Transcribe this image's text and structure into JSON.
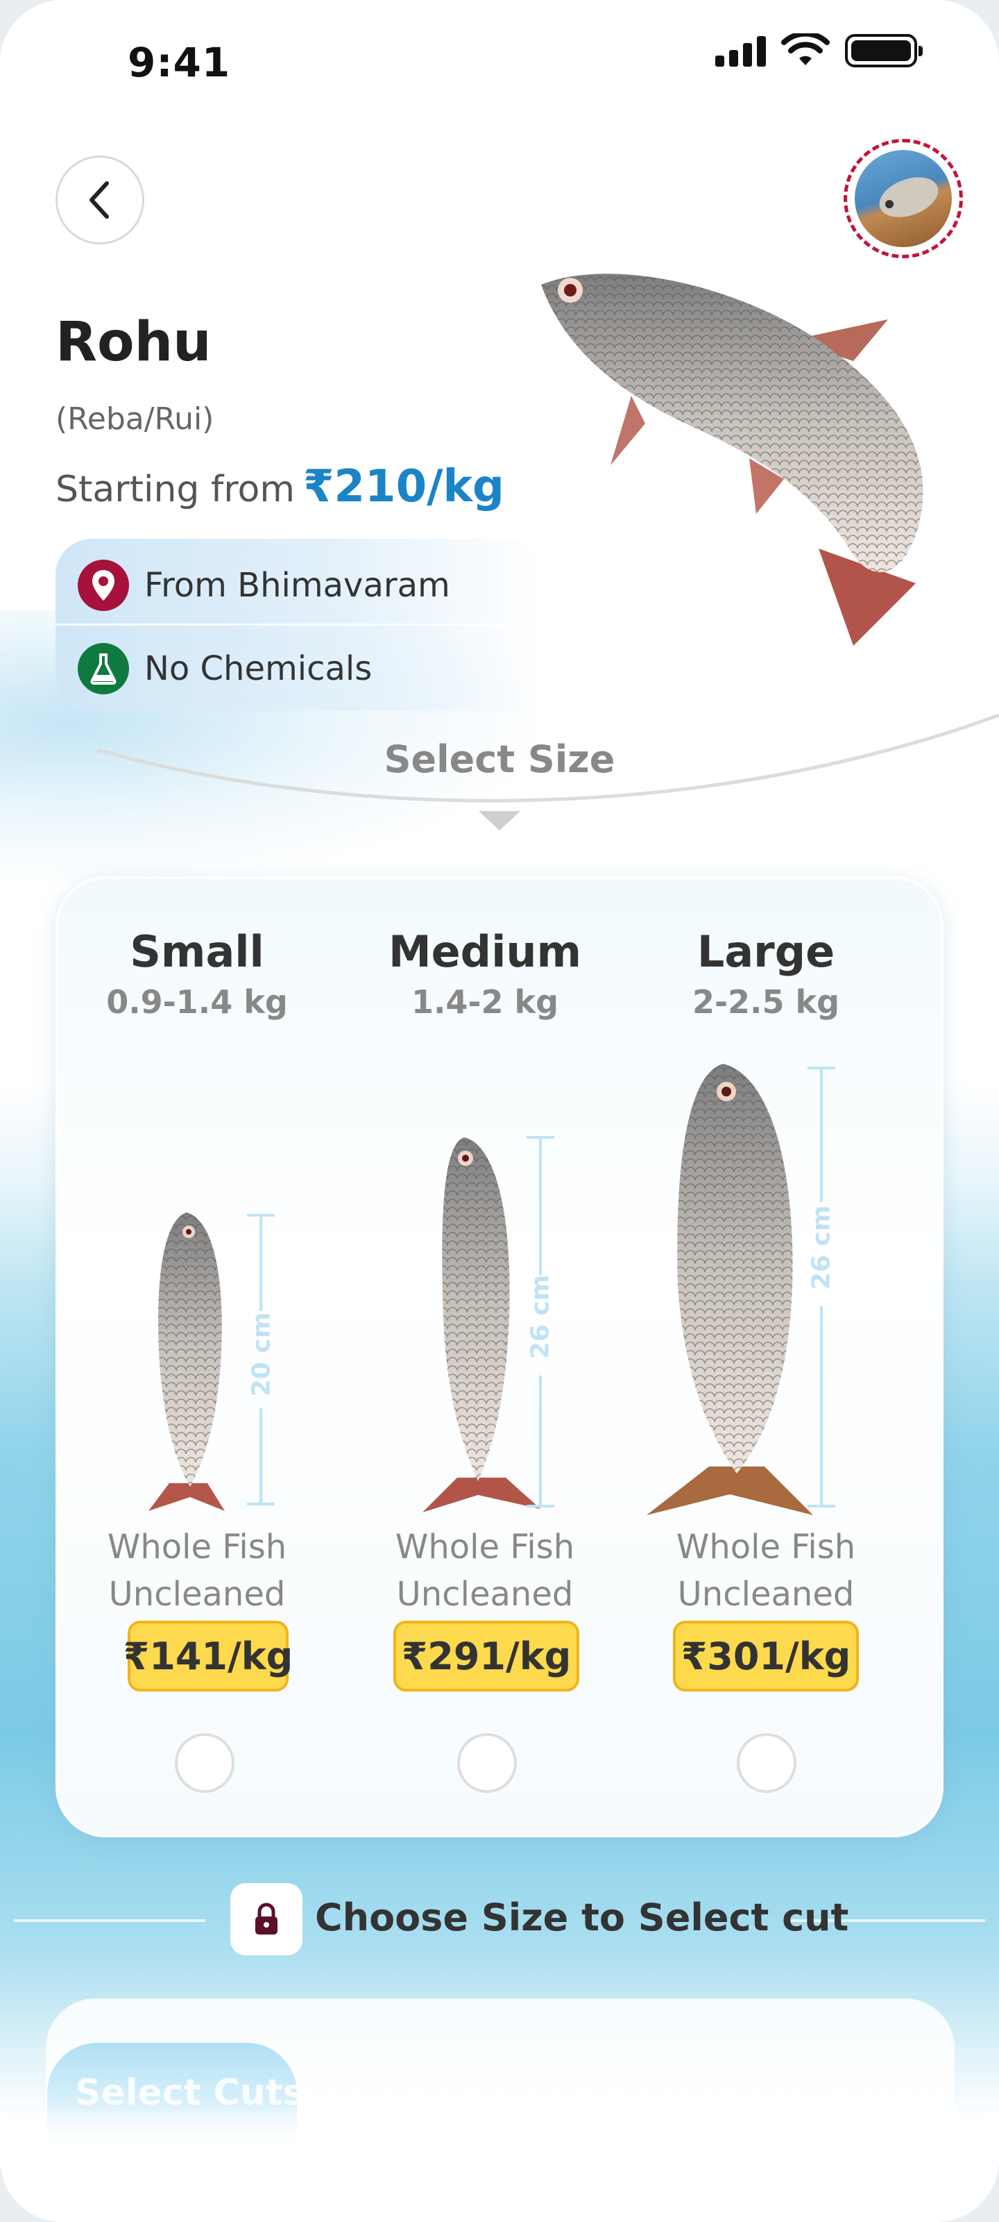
{
  "status_bar": {
    "time": "9:41"
  },
  "product": {
    "name": "Rohu",
    "alt_names": "(Reba/Rui)",
    "starting_label": "Starting from",
    "starting_price": "₹210/kg",
    "tags": [
      {
        "label": "From Bhimavaram",
        "icon": "location-pin-icon",
        "color": "#a6123b"
      },
      {
        "label": "No Chemicals",
        "icon": "flask-icon",
        "color": "#0f7a3e"
      }
    ]
  },
  "size_section": {
    "heading": "Select Size"
  },
  "sizes": [
    {
      "name": "Small",
      "weight": "0.9-1.4 kg",
      "length": "20 cm",
      "desc1": "Whole Fish",
      "desc2": "Uncleaned",
      "price": "₹141/kg",
      "selected": false
    },
    {
      "name": "Medium",
      "weight": "1.4-2 kg",
      "length": "26 cm",
      "desc1": "Whole Fish",
      "desc2": "Uncleaned",
      "price": "₹291/kg",
      "selected": false
    },
    {
      "name": "Large",
      "weight": "2-2.5 kg",
      "length": "26 cm",
      "desc1": "Whole Fish",
      "desc2": "Uncleaned",
      "price": "₹301/kg",
      "selected": false
    }
  ],
  "cut_section": {
    "prompt": "Choose Size to Select cut",
    "tab_label": "Select Cuts"
  },
  "colors": {
    "accent_price": "#1a84c7",
    "price_badge": "#fdd94e",
    "brand_red": "#a6123b"
  }
}
